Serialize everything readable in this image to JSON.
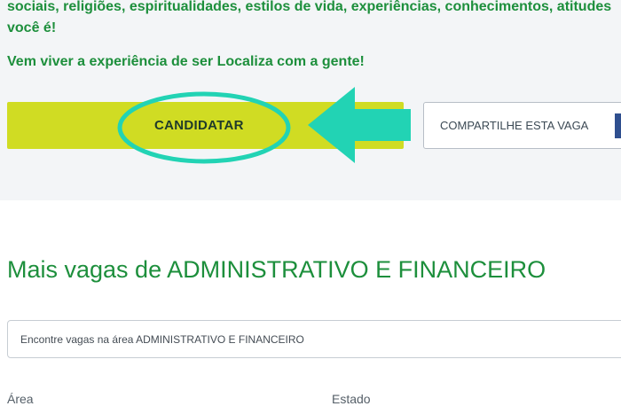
{
  "description": {
    "line1": "sociais, religiões, espiritualidades, estilos de vida, experiências, conhecimentos, atitudes",
    "line2": "você é!",
    "line3": "Vem viver a experiência de ser Localiza com a gente!"
  },
  "actions": {
    "apply_label": "CANDIDATAR",
    "share_label": "COMPARTILHE ESTA VAGA"
  },
  "more_jobs": {
    "title": "Mais vagas de ADMINISTRATIVO E FINANCEIRO",
    "search_placeholder": "Encontre vagas na área ADMINISTRATIVO E FINANCEIRO"
  },
  "filters": {
    "area_label": "Área",
    "state_label": "Estado"
  },
  "colors": {
    "brand_green": "#1d8f3c",
    "apply_button": "#d0dc23",
    "annotation_teal": "#22d3b4"
  }
}
